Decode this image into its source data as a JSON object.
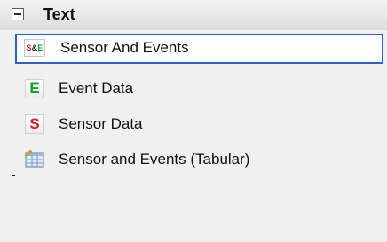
{
  "group": {
    "title": "Text",
    "expanded": true
  },
  "items": [
    {
      "label": "Sensor And Events",
      "icon": "sensor-and-events-icon",
      "icon_text": [
        "S",
        "&",
        "E"
      ],
      "icon_colors": [
        "#d42020",
        "#222222",
        "#1a9a2a"
      ],
      "selected": true
    },
    {
      "label": "Event Data",
      "icon": "event-data-icon",
      "icon_text": "E",
      "icon_color": "#1a9a2a",
      "selected": false
    },
    {
      "label": "Sensor Data",
      "icon": "sensor-data-icon",
      "icon_text": "S",
      "icon_color": "#d42020",
      "selected": false
    },
    {
      "label": "Sensor and Events (Tabular)",
      "icon": "tabular-grid-icon",
      "selected": false
    }
  ],
  "colors": {
    "selection_border": "#2b5fd9",
    "header_gradient_top": "#f4f4f4",
    "header_gradient_bottom": "#dcdcdc"
  }
}
